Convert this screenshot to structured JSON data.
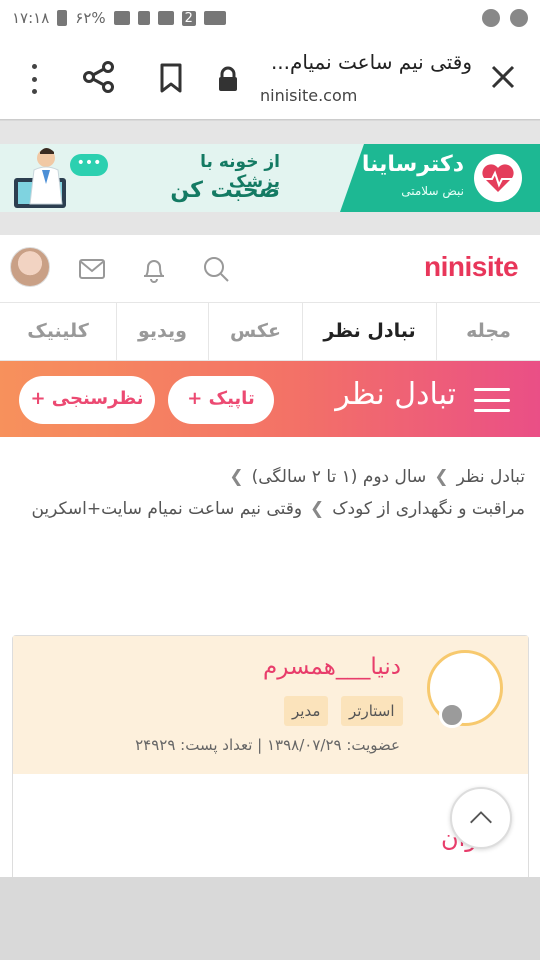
{
  "status_bar": {
    "time": "۱۷:۱۸",
    "battery": "۶۲%",
    "sim_badge": "2"
  },
  "browser": {
    "page_title": "وقتی نیم ساعت نمیام...",
    "domain": "ninisite.com"
  },
  "ad": {
    "bubble": "•••",
    "cta_line1": "از خونه با پزشک",
    "cta_line2": "صحبت کن",
    "brand": "دکترساینا",
    "brand_tagline": "نبض سلامتی"
  },
  "site": {
    "logo": "ninisite"
  },
  "tabs": [
    {
      "label": "مجله"
    },
    {
      "label": "تبادل نظر"
    },
    {
      "label": "عکس"
    },
    {
      "label": "ویدیو"
    },
    {
      "label": "کلینیک"
    }
  ],
  "section": {
    "title": "تبادل نظر",
    "topic_button": "تاپیک +",
    "poll_button": "نظرسنجی +"
  },
  "breadcrumb": [
    "تبادل نظر",
    "سال دوم (۱ تا ۲ سالگی)",
    "مراقبت و نگهداری از کودک",
    "وقتی نیم ساعت نمیام سایت+اسکرین"
  ],
  "post": {
    "author": "دنیا___همسرم",
    "badges": [
      "استارتر",
      "مدیر"
    ],
    "meta": "عضویت: ۱۳۹۸/۰۷/۲۹ | تعداد پست: ۲۴۹۲۹",
    "heading": "عنوان"
  },
  "colors": {
    "brand_pink": "#e8365a",
    "bar_gradient_start": "#f7915c",
    "bar_gradient_end": "#ea4f86",
    "ad_green": "#1db893",
    "card_header_bg": "#fdf0dc"
  }
}
